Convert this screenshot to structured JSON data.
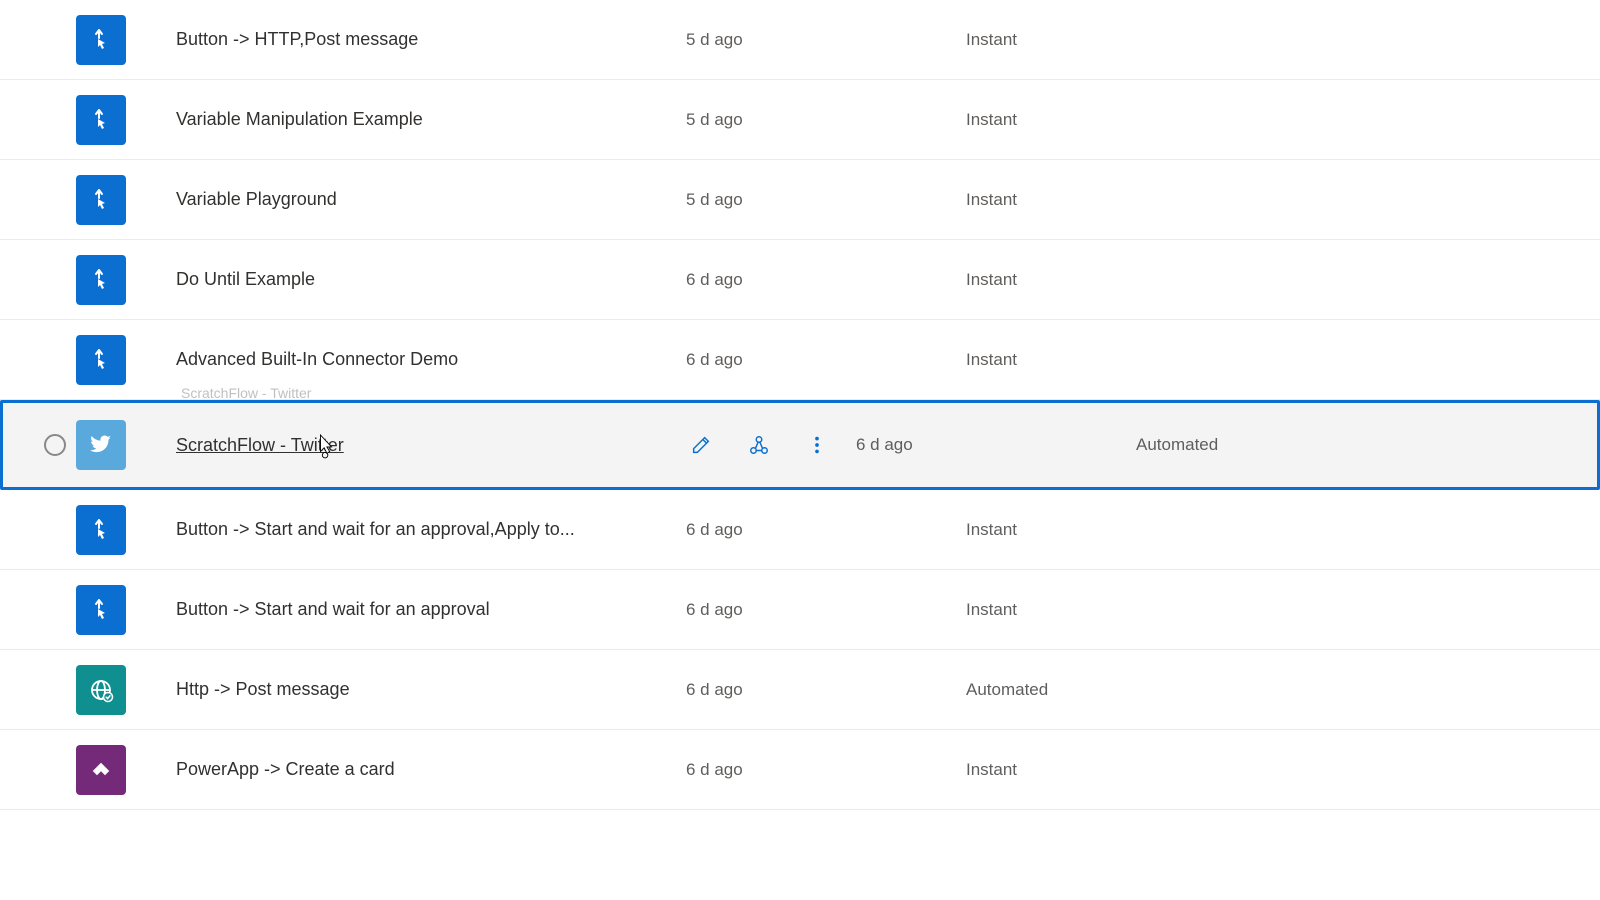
{
  "flows": [
    {
      "name": "Button -> HTTP,Post message",
      "modified": "5 d ago",
      "type": "Instant",
      "icon": "button",
      "hovered": false
    },
    {
      "name": "Variable Manipulation Example",
      "modified": "5 d ago",
      "type": "Instant",
      "icon": "button",
      "hovered": false
    },
    {
      "name": "Variable Playground",
      "modified": "5 d ago",
      "type": "Instant",
      "icon": "button",
      "hovered": false
    },
    {
      "name": "Do Until Example",
      "modified": "6 d ago",
      "type": "Instant",
      "icon": "button",
      "hovered": false
    },
    {
      "name": "Advanced Built-In Connector Demo",
      "modified": "6 d ago",
      "type": "Instant",
      "icon": "button",
      "hovered": false
    },
    {
      "name": "ScratchFlow - Twitter",
      "modified": "6 d ago",
      "type": "Automated",
      "icon": "twitter",
      "hovered": true
    },
    {
      "name": "Button -> Start and wait for an approval,Apply to...",
      "modified": "6 d ago",
      "type": "Instant",
      "icon": "button",
      "hovered": false
    },
    {
      "name": "Button -> Start and wait for an approval",
      "modified": "6 d ago",
      "type": "Instant",
      "icon": "button",
      "hovered": false
    },
    {
      "name": "Http -> Post message",
      "modified": "6 d ago",
      "type": "Automated",
      "icon": "http",
      "hovered": false
    },
    {
      "name": "PowerApp -> Create a card",
      "modified": "6 d ago",
      "type": "Instant",
      "icon": "powerapps",
      "hovered": false
    }
  ],
  "tooltip_ghost": "ScratchFlow - Twitter"
}
